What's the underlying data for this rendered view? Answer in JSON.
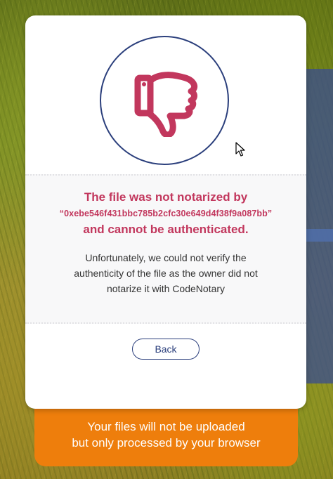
{
  "result": {
    "title_line1": "The file was not notarized by",
    "signer_hash": "“0xebe546f431bbc785b2cfc30e649d4f38f9a087bb”",
    "title_line3": "and cannot be authenticated.",
    "description": "Unfortunately, we could not verify the authenticity of the file as the owner did not notarize it with CodeNotary",
    "icon": "thumbs-down-icon"
  },
  "actions": {
    "back_label": "Back"
  },
  "notice": {
    "line1": "Your files will not be uploaded",
    "line2": "but only processed by your browser"
  },
  "colors": {
    "accent_red": "#c2375d",
    "brand_blue": "#2b3f7c",
    "notice_orange": "#ee7e0c"
  }
}
